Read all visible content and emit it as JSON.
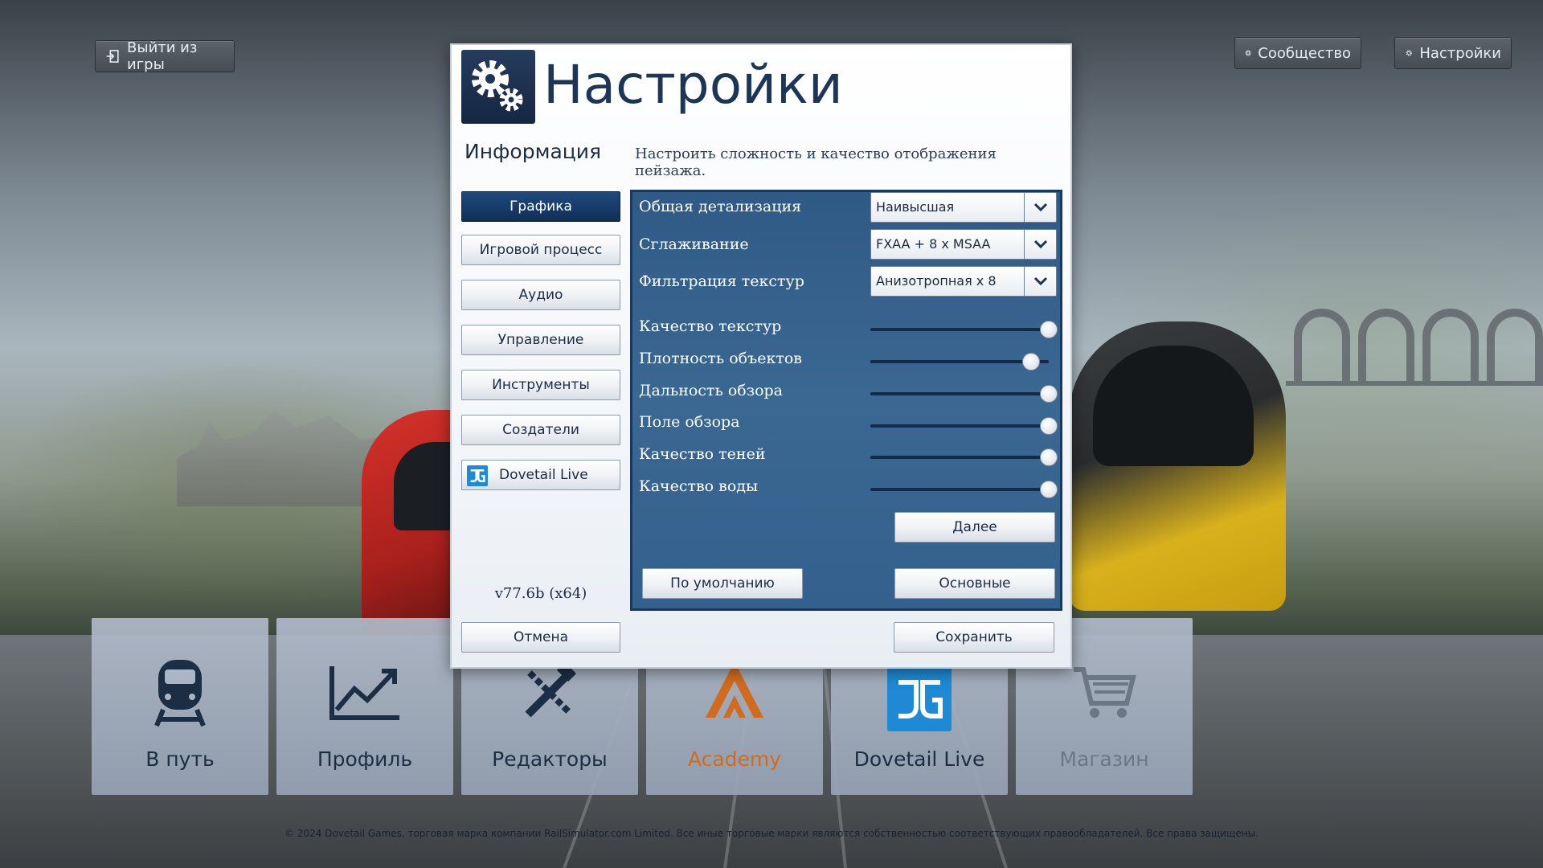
{
  "top": {
    "exit_label": "Выйти из игры",
    "community_label": "Сообщество",
    "settings_label": "Настройки"
  },
  "tiles": [
    {
      "label": "В путь",
      "icon": "train-icon"
    },
    {
      "label": "Профиль",
      "icon": "chart-line-icon"
    },
    {
      "label": "Редакторы",
      "icon": "tools-icon"
    },
    {
      "label": "Academy",
      "icon": "academy-logo-icon"
    },
    {
      "label": "Dovetail Live",
      "icon": "dovetail-live-icon"
    },
    {
      "label": "Магазин",
      "icon": "shopping-cart-icon"
    }
  ],
  "copyright": "© 2024 Dovetail Games, торговая марка компании RailSimulator.com Limited. Все иные торговые марки являются собственностью соответствующих правообладателей. Все права защищены.",
  "dialog": {
    "title": "Настройки",
    "subtitle": "Информация",
    "description": "Настроить сложность и качество отображения пейзажа.",
    "nav": [
      {
        "label": "Графика",
        "active": true
      },
      {
        "label": "Игровой процесс"
      },
      {
        "label": "Аудио"
      },
      {
        "label": "Управление"
      },
      {
        "label": "Инструменты"
      },
      {
        "label": "Создатели"
      },
      {
        "label": "Dovetail Live",
        "icon": "dovetail-live-icon"
      }
    ],
    "version": "v77.6b (x64)",
    "cancel_label": "Отмена",
    "save_label": "Сохранить",
    "graphics": {
      "dropdowns": [
        {
          "label": "Общая детализация",
          "value": "Наивысшая"
        },
        {
          "label": "Сглаживание",
          "value": "FXAA + 8 x MSAA"
        },
        {
          "label": "Фильтрация текстур",
          "value": "Анизотропная x 8"
        }
      ],
      "sliders": [
        {
          "label": "Качество текстур",
          "level": 1.0
        },
        {
          "label": "Плотность объектов",
          "level": 0.9
        },
        {
          "label": "Дальность обзора",
          "level": 1.0
        },
        {
          "label": "Поле обзора",
          "level": 1.0
        },
        {
          "label": "Качество теней",
          "level": 1.0
        },
        {
          "label": "Качество воды",
          "level": 1.0
        }
      ],
      "next_label": "Далее",
      "default_label": "По умолчанию",
      "basic_label": "Основные"
    }
  },
  "colors": {
    "accent": "#1d3556",
    "active_nav": "#143a68",
    "panel": "#3b6892",
    "academy": "#d36b1e"
  }
}
